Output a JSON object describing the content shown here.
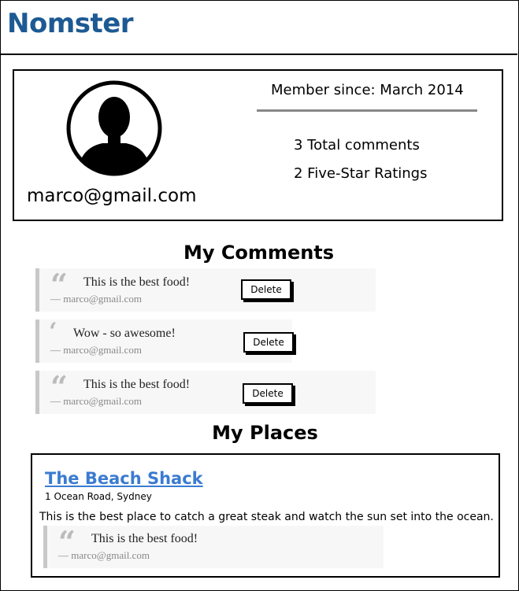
{
  "app": {
    "title": "Nomster"
  },
  "profile": {
    "email": "marco@gmail.com",
    "member_since": "Member since: March 2014",
    "total_comments": "3 Total comments",
    "five_star": "2 Five-Star Ratings"
  },
  "comments_section": {
    "title": "My Comments"
  },
  "comments": [
    {
      "text": "This is the best food!",
      "author": "— marco@gmail.com",
      "delete_label": "Delete"
    },
    {
      "text": "Wow - so awesome!",
      "author": "— marco@gmail.com",
      "delete_label": "Delete"
    },
    {
      "text": "This is the best food!",
      "author": "— marco@gmail.com",
      "delete_label": "Delete"
    }
  ],
  "places_section": {
    "title": "My Places"
  },
  "places": [
    {
      "name": "The Beach Shack",
      "address": "1 Ocean Road, Sydney",
      "description": "This is the best place to catch a great steak and watch the sun set into the ocean.",
      "comment": {
        "text": "This is the best food!",
        "author": "— marco@gmail.com"
      }
    }
  ],
  "colors": {
    "brand": "#1d5a93",
    "link": "#3b7bd1",
    "quote_border": "#c8c8c8"
  },
  "icons": {
    "avatar": "user-silhouette-icon",
    "quote": "quote-mark-icon"
  }
}
